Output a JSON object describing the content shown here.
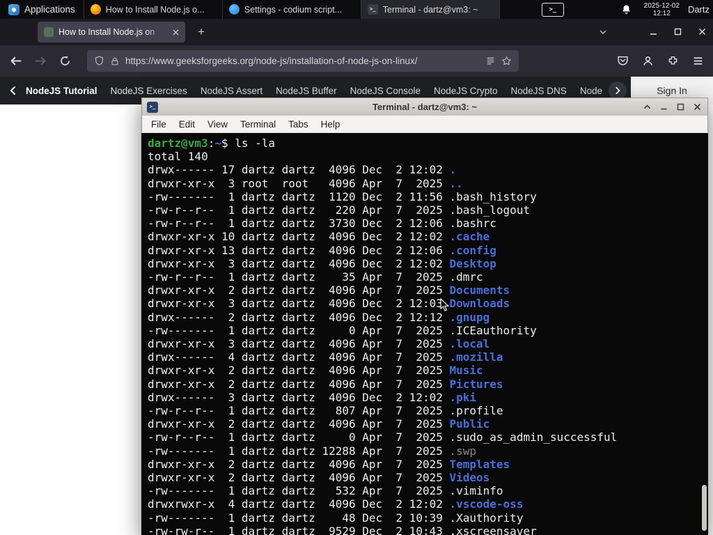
{
  "colors": {
    "accent_green": "#2f8d46",
    "terminal_dir_blue": "#4a6fd8",
    "terminal_prompt_green": "#3fa63f",
    "terminal_dim_gray": "#8a8a8a",
    "firefox_toolbar": "#2b2a33",
    "panel_black": "#0c0c10"
  },
  "taskbar": {
    "applications": "Applications",
    "windows": [
      {
        "icon": "firefox",
        "label": "How to Install Node.js o...",
        "active": false
      },
      {
        "icon": "codium",
        "label": "Settings - codium script...",
        "active": false
      },
      {
        "icon": "terminal",
        "label": "Terminal - dartz@vm3: ~",
        "active": true
      }
    ],
    "date": "2025-12-02",
    "time": "12:12",
    "user": "Dartz"
  },
  "browser": {
    "tab_title": "How to Install Node.js on",
    "url": "https://www.geeksforgeeks.org/node-js/installation-of-node-js-on-linux/",
    "site_nav": {
      "active_item": "NodeJS Tutorial",
      "items": [
        "NodeJS Exercises",
        "NodeJS Assert",
        "NodeJS Buffer",
        "NodeJS Console",
        "NodeJS Crypto",
        "NodeJS DNS",
        "Node"
      ],
      "sign_in_label": "Sign In"
    }
  },
  "terminal": {
    "window_title": "Terminal - dartz@vm3: ~",
    "menu_items": [
      "File",
      "Edit",
      "View",
      "Terminal",
      "Tabs",
      "Help"
    ],
    "prompt_segments": [
      {
        "text": "dartz@vm3",
        "color": "green"
      },
      {
        "text": ":",
        "color": "default"
      },
      {
        "text": "~",
        "color": "blue"
      },
      {
        "text": "$ ",
        "color": "default"
      },
      {
        "text": "ls -la",
        "color": "default"
      }
    ],
    "total_line": "total 140",
    "listing": [
      {
        "pre": "drwx------ 17 dartz dartz  4096 Dec  2 12:02 ",
        "name": ".",
        "type": "dir"
      },
      {
        "pre": "drwxr-xr-x  3 root  root   4096 Apr  7  2025 ",
        "name": "..",
        "type": "dir"
      },
      {
        "pre": "-rw-------  1 dartz dartz  1120 Dec  2 11:56 ",
        "name": ".bash_history",
        "type": "file"
      },
      {
        "pre": "-rw-r--r--  1 dartz dartz   220 Apr  7  2025 ",
        "name": ".bash_logout",
        "type": "file"
      },
      {
        "pre": "-rw-r--r--  1 dartz dartz  3730 Dec  2 12:06 ",
        "name": ".bashrc",
        "type": "file"
      },
      {
        "pre": "drwxr-xr-x 10 dartz dartz  4096 Dec  2 12:02 ",
        "name": ".cache",
        "type": "dir"
      },
      {
        "pre": "drwxr-xr-x 13 dartz dartz  4096 Dec  2 12:06 ",
        "name": ".config",
        "type": "dir"
      },
      {
        "pre": "drwxr-xr-x  3 dartz dartz  4096 Dec  2 12:02 ",
        "name": "Desktop",
        "type": "dir"
      },
      {
        "pre": "-rw-r--r--  1 dartz dartz    35 Apr  7  2025 ",
        "name": ".dmrc",
        "type": "file"
      },
      {
        "pre": "drwxr-xr-x  2 dartz dartz  4096 Apr  7  2025 ",
        "name": "Documents",
        "type": "dir"
      },
      {
        "pre": "drwxr-xr-x  3 dartz dartz  4096 Dec  2 12:03 ",
        "name": "Downloads",
        "type": "dir"
      },
      {
        "pre": "drwx------  2 dartz dartz  4096 Dec  2 12:12 ",
        "name": ".gnupg",
        "type": "dir"
      },
      {
        "pre": "-rw-------  1 dartz dartz     0 Apr  7  2025 ",
        "name": ".ICEauthority",
        "type": "file"
      },
      {
        "pre": "drwxr-xr-x  3 dartz dartz  4096 Apr  7  2025 ",
        "name": ".local",
        "type": "dir"
      },
      {
        "pre": "drwx------  4 dartz dartz  4096 Apr  7  2025 ",
        "name": ".mozilla",
        "type": "dir"
      },
      {
        "pre": "drwxr-xr-x  2 dartz dartz  4096 Apr  7  2025 ",
        "name": "Music",
        "type": "dir"
      },
      {
        "pre": "drwxr-xr-x  2 dartz dartz  4096 Apr  7  2025 ",
        "name": "Pictures",
        "type": "dir"
      },
      {
        "pre": "drwx------  3 dartz dartz  4096 Dec  2 12:02 ",
        "name": ".pki",
        "type": "dir"
      },
      {
        "pre": "-rw-r--r--  1 dartz dartz   807 Apr  7  2025 ",
        "name": ".profile",
        "type": "file"
      },
      {
        "pre": "drwxr-xr-x  2 dartz dartz  4096 Apr  7  2025 ",
        "name": "Public",
        "type": "dir"
      },
      {
        "pre": "-rw-r--r--  1 dartz dartz     0 Apr  7  2025 ",
        "name": ".sudo_as_admin_successful",
        "type": "file"
      },
      {
        "pre": "-rw-------  1 dartz dartz 12288 Apr  7  2025 ",
        "name": ".swp",
        "type": "dim"
      },
      {
        "pre": "drwxr-xr-x  2 dartz dartz  4096 Apr  7  2025 ",
        "name": "Templates",
        "type": "dir"
      },
      {
        "pre": "drwxr-xr-x  2 dartz dartz  4096 Apr  7  2025 ",
        "name": "Videos",
        "type": "dir"
      },
      {
        "pre": "-rw-------  1 dartz dartz   532 Apr  7  2025 ",
        "name": ".viminfo",
        "type": "file"
      },
      {
        "pre": "drwxrwxr-x  4 dartz dartz  4096 Dec  2 12:02 ",
        "name": ".vscode-oss",
        "type": "dir"
      },
      {
        "pre": "-rw-------  1 dartz dartz    48 Dec  2 10:39 ",
        "name": ".Xauthority",
        "type": "file"
      },
      {
        "pre": "-rw-rw-r--  1 dartz dartz  9529 Dec  2 10:43 ",
        "name": ".xscreensaver",
        "type": "file"
      }
    ]
  }
}
